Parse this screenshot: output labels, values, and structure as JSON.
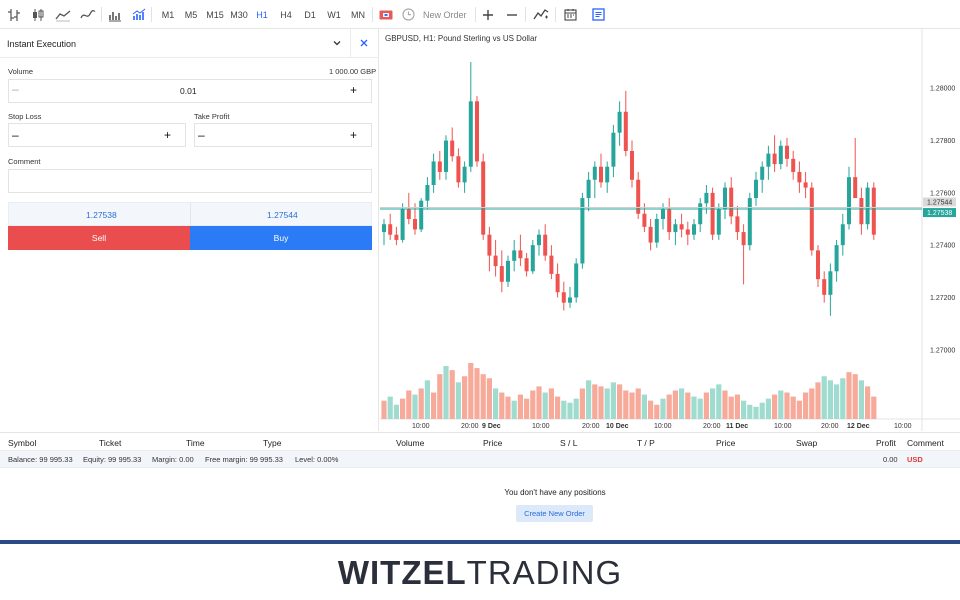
{
  "toolbar": {
    "timeframes": [
      "M1",
      "M5",
      "M15",
      "M30",
      "H1",
      "H4",
      "D1",
      "W1",
      "MN"
    ],
    "active_timeframe": "H1",
    "new_order_label": "New Order",
    "icons": [
      "bar-chart-icon",
      "candlestick-icon",
      "line-chart-icon",
      "trend-icon",
      "volume-icon",
      "indicators-icon",
      "one-click-trading-icon",
      "zoom-in-icon",
      "zoom-out-icon",
      "indicator-icon",
      "calendar-icon",
      "panel-icon"
    ]
  },
  "order_panel": {
    "title": "Instant Execution",
    "volume_label": "Volume",
    "volume_units": "1 000.00 GBP",
    "volume_value": "0.01",
    "stop_loss_label": "Stop Loss",
    "take_profit_label": "Take Profit",
    "comment_label": "Comment",
    "sell_price": "1.27538",
    "buy_price": "1.27544",
    "sell_label": "Sell",
    "buy_label": "Buy"
  },
  "chart": {
    "title": "GBPUSD, H1: Pound Sterling vs US Dollar",
    "bid_label": "1.27538",
    "ask_label": "1.27544"
  },
  "chart_data": {
    "type": "candlestick",
    "title": "GBPUSD, H1: Pound Sterling vs US Dollar",
    "y_ticks": [
      "1.28000",
      "1.27800",
      "1.27600",
      "1.27400",
      "1.27200",
      "1.27000"
    ],
    "x_ticks": [
      "10:00",
      "20:00",
      "9 Dec",
      "10:00",
      "20:00",
      "10 Dec",
      "10:00",
      "20:00",
      "11 Dec",
      "10:00",
      "20:00",
      "12 Dec",
      "10:00"
    ],
    "ylim": [
      1.2685,
      1.2815
    ],
    "bid": 1.27538,
    "ask": 1.27544,
    "candles": [
      [
        1.2745,
        1.275,
        1.274,
        1.2748
      ],
      [
        1.2748,
        1.2752,
        1.2742,
        1.2744
      ],
      [
        1.2744,
        1.2747,
        1.274,
        1.2742
      ],
      [
        1.2742,
        1.2756,
        1.2741,
        1.2754
      ],
      [
        1.2754,
        1.276,
        1.2748,
        1.275
      ],
      [
        1.275,
        1.2756,
        1.2744,
        1.2746
      ],
      [
        1.2746,
        1.2758,
        1.2745,
        1.2757
      ],
      [
        1.2757,
        1.2766,
        1.2754,
        1.2763
      ],
      [
        1.2763,
        1.2775,
        1.276,
        1.2772
      ],
      [
        1.2772,
        1.2776,
        1.2765,
        1.2768
      ],
      [
        1.2768,
        1.2782,
        1.2765,
        1.278
      ],
      [
        1.278,
        1.2785,
        1.2772,
        1.2774
      ],
      [
        1.2774,
        1.2777,
        1.2762,
        1.2764
      ],
      [
        1.2764,
        1.2772,
        1.276,
        1.277
      ],
      [
        1.277,
        1.281,
        1.2768,
        1.2795
      ],
      [
        1.2795,
        1.2797,
        1.277,
        1.2772
      ],
      [
        1.2772,
        1.2775,
        1.2742,
        1.2744
      ],
      [
        1.2744,
        1.2747,
        1.273,
        1.2736
      ],
      [
        1.2736,
        1.2742,
        1.2728,
        1.2732
      ],
      [
        1.2732,
        1.2738,
        1.2722,
        1.2726
      ],
      [
        1.2726,
        1.2736,
        1.2724,
        1.2734
      ],
      [
        1.2734,
        1.2742,
        1.273,
        1.2738
      ],
      [
        1.2738,
        1.2744,
        1.2732,
        1.2735
      ],
      [
        1.2735,
        1.2737,
        1.2728,
        1.273
      ],
      [
        1.273,
        1.2742,
        1.2729,
        1.274
      ],
      [
        1.274,
        1.2746,
        1.2736,
        1.2744
      ],
      [
        1.2744,
        1.2748,
        1.2734,
        1.2736
      ],
      [
        1.2736,
        1.274,
        1.2727,
        1.2729
      ],
      [
        1.2729,
        1.2733,
        1.272,
        1.2722
      ],
      [
        1.2722,
        1.2726,
        1.2715,
        1.2718
      ],
      [
        1.2718,
        1.2724,
        1.2716,
        1.272
      ],
      [
        1.272,
        1.2735,
        1.2718,
        1.2733
      ],
      [
        1.2733,
        1.276,
        1.2731,
        1.2758
      ],
      [
        1.2758,
        1.2768,
        1.2753,
        1.2765
      ],
      [
        1.2765,
        1.2772,
        1.2758,
        1.277
      ],
      [
        1.277,
        1.2775,
        1.2762,
        1.2764
      ],
      [
        1.2764,
        1.2772,
        1.276,
        1.277
      ],
      [
        1.277,
        1.2786,
        1.2766,
        1.2783
      ],
      [
        1.2783,
        1.2795,
        1.2778,
        1.2791
      ],
      [
        1.2791,
        1.2799,
        1.2774,
        1.2776
      ],
      [
        1.2776,
        1.278,
        1.2762,
        1.2765
      ],
      [
        1.2765,
        1.2768,
        1.275,
        1.2752
      ],
      [
        1.2752,
        1.2756,
        1.2745,
        1.2747
      ],
      [
        1.2747,
        1.275,
        1.2738,
        1.2741
      ],
      [
        1.2741,
        1.2752,
        1.2739,
        1.275
      ],
      [
        1.275,
        1.2756,
        1.2746,
        1.2754
      ],
      [
        1.2754,
        1.2758,
        1.2742,
        1.2745
      ],
      [
        1.2745,
        1.275,
        1.274,
        1.2748
      ],
      [
        1.2748,
        1.2752,
        1.2743,
        1.2746
      ],
      [
        1.2746,
        1.2749,
        1.274,
        1.2744
      ],
      [
        1.2744,
        1.275,
        1.2742,
        1.2748
      ],
      [
        1.2748,
        1.2758,
        1.2745,
        1.2756
      ],
      [
        1.2756,
        1.2763,
        1.2752,
        1.276
      ],
      [
        1.276,
        1.2762,
        1.2742,
        1.2744
      ],
      [
        1.2744,
        1.2756,
        1.2742,
        1.2754
      ],
      [
        1.2754,
        1.2764,
        1.275,
        1.2762
      ],
      [
        1.2762,
        1.2766,
        1.2748,
        1.2751
      ],
      [
        1.2751,
        1.2755,
        1.2742,
        1.2745
      ],
      [
        1.2745,
        1.2748,
        1.2725,
        1.274
      ],
      [
        1.274,
        1.276,
        1.2738,
        1.2758
      ],
      [
        1.2758,
        1.2768,
        1.2755,
        1.2765
      ],
      [
        1.2765,
        1.2772,
        1.276,
        1.277
      ],
      [
        1.277,
        1.2778,
        1.2765,
        1.2775
      ],
      [
        1.2775,
        1.2782,
        1.2768,
        1.2771
      ],
      [
        1.2771,
        1.278,
        1.2769,
        1.2778
      ],
      [
        1.2778,
        1.2781,
        1.277,
        1.2773
      ],
      [
        1.2773,
        1.2776,
        1.2765,
        1.2768
      ],
      [
        1.2768,
        1.2772,
        1.276,
        1.2764
      ],
      [
        1.2764,
        1.2768,
        1.2758,
        1.2762
      ],
      [
        1.2762,
        1.2764,
        1.2736,
        1.2738
      ],
      [
        1.2738,
        1.274,
        1.2724,
        1.2727
      ],
      [
        1.2727,
        1.273,
        1.2718,
        1.2721
      ],
      [
        1.2721,
        1.2733,
        1.2713,
        1.273
      ],
      [
        1.273,
        1.2742,
        1.2726,
        1.274
      ],
      [
        1.274,
        1.2752,
        1.2736,
        1.2748
      ],
      [
        1.2748,
        1.277,
        1.2746,
        1.2766
      ],
      [
        1.2766,
        1.2781,
        1.2762,
        1.2758
      ],
      [
        1.2758,
        1.2762,
        1.2744,
        1.2748
      ],
      [
        1.2748,
        1.2764,
        1.2746,
        1.2762
      ],
      [
        1.2762,
        1.2764,
        1.2742,
        1.2744
      ]
    ],
    "volumes": [
      18,
      22,
      14,
      20,
      28,
      24,
      30,
      38,
      26,
      44,
      52,
      48,
      36,
      42,
      55,
      50,
      44,
      40,
      30,
      26,
      22,
      18,
      24,
      20,
      28,
      32,
      26,
      30,
      22,
      18,
      16,
      20,
      30,
      38,
      34,
      32,
      30,
      36,
      34,
      28,
      26,
      30,
      24,
      18,
      14,
      20,
      24,
      28,
      30,
      26,
      22,
      20,
      26,
      30,
      34,
      28,
      22,
      24,
      18,
      14,
      12,
      16,
      20,
      24,
      28,
      26,
      22,
      18,
      26,
      30,
      36,
      42,
      38,
      34,
      40,
      46,
      44,
      38,
      32,
      22
    ],
    "volume_up": [
      false,
      true,
      true,
      false,
      false,
      true,
      false,
      true,
      false,
      false,
      true,
      false,
      true,
      false,
      false,
      false,
      false,
      false,
      true,
      false,
      false,
      true,
      false,
      false,
      false,
      false,
      true,
      false,
      false,
      true,
      true,
      true,
      false,
      true,
      false,
      false,
      true,
      true,
      false,
      false,
      false,
      false,
      true,
      false,
      false,
      true,
      false,
      false,
      true,
      false,
      true,
      true,
      false,
      true,
      true,
      false,
      false,
      false,
      true,
      true,
      true,
      true,
      true,
      false,
      true,
      false,
      false,
      false,
      false,
      false,
      false,
      true,
      true,
      true,
      true,
      false,
      false,
      true,
      false,
      false
    ]
  },
  "positions_table": {
    "headers": [
      "Symbol",
      "Ticket",
      "Time",
      "Type",
      "Volume",
      "Price",
      "S / L",
      "T / P",
      "Price",
      "Swap",
      "Profit",
      "Comment"
    ],
    "balance": "Balance: 99 995.33",
    "equity": "Equity: 99 995.33",
    "margin": "Margin: 0.00",
    "free_margin": "Free margin: 99 995.33",
    "level": "Level: 0.00%",
    "profit_total": "0.00",
    "currency": "USD",
    "empty_message": "You don't have any positions",
    "create_order_label": "Create New Order"
  },
  "footer": {
    "brand_bold": "WITZEL",
    "brand_light": "TRADING"
  },
  "colors": {
    "up": "#26a69a",
    "down": "#ef5350",
    "volume_up": "#9fdccf",
    "volume_down": "#f7a99a",
    "sell": "#ea4d4d",
    "buy": "#2b7bf6",
    "accent": "#2962ff"
  }
}
